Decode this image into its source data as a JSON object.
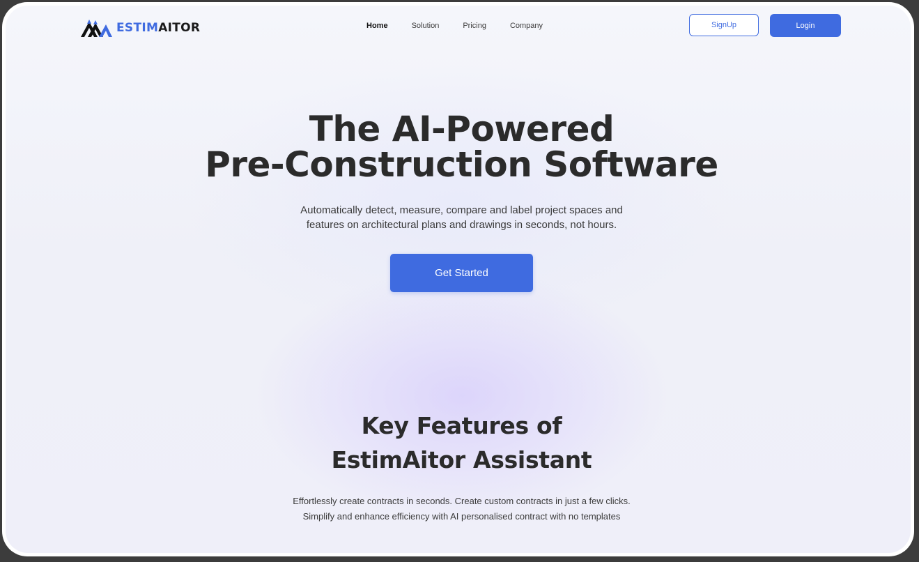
{
  "brand": {
    "name_accent": "ESTIM",
    "name_rest": "AITOR",
    "logo_icon": "mountain-peaks-logo-icon"
  },
  "nav": {
    "items": [
      {
        "label": "Home",
        "active": true
      },
      {
        "label": "Solution",
        "active": false
      },
      {
        "label": "Pricing",
        "active": false
      },
      {
        "label": "Company",
        "active": false
      }
    ],
    "signup_label": "SignUp",
    "login_label": "Login"
  },
  "hero": {
    "title_line1": "The AI-Powered",
    "title_line2": "Pre-Construction Software",
    "subtitle_line1": "Automatically detect, measure, compare and label project spaces and",
    "subtitle_line2": "features on architectural plans and drawings in seconds, not hours.",
    "cta_label": "Get Started"
  },
  "features": {
    "title_line1": "Key Features of",
    "title_line2": "EstimAitor Assistant",
    "desc_line1": "Effortlessly create contracts in seconds. Create custom contracts in just a few clicks.",
    "desc_line2": "Simplify and enhance efficiency with AI personalised contract with no templates"
  },
  "colors": {
    "accent": "#3f6be0",
    "text_dark": "#2b2b2b",
    "frame": "#3c3c3c"
  }
}
